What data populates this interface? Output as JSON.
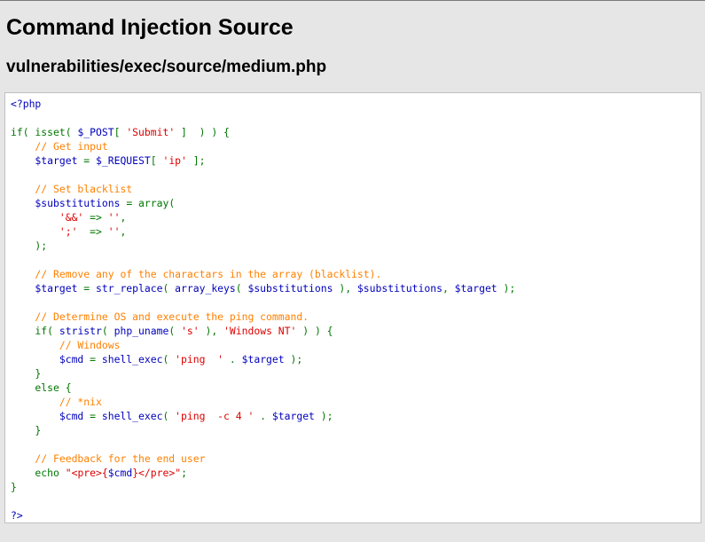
{
  "page": {
    "title": "Command Injection Source",
    "file_path": "vulnerabilities/exec/source/medium.php"
  },
  "code_lines": [
    [
      {
        "c": "kw",
        "t": "<?php"
      }
    ],
    [],
    [
      {
        "c": "grn",
        "t": "if( isset( "
      },
      {
        "c": "kw",
        "t": "$_POST"
      },
      {
        "c": "grn",
        "t": "[ "
      },
      {
        "c": "str",
        "t": "'Submit'"
      },
      {
        "c": "grn",
        "t": " ]  ) ) {"
      }
    ],
    [
      {
        "c": "com",
        "t": "    // Get input"
      }
    ],
    [
      {
        "c": "kw",
        "t": "    $target "
      },
      {
        "c": "grn",
        "t": "= "
      },
      {
        "c": "kw",
        "t": "$_REQUEST"
      },
      {
        "c": "grn",
        "t": "[ "
      },
      {
        "c": "str",
        "t": "'ip'"
      },
      {
        "c": "grn",
        "t": " ];"
      }
    ],
    [],
    [
      {
        "c": "com",
        "t": "    // Set blacklist"
      }
    ],
    [
      {
        "c": "kw",
        "t": "    $substitutions "
      },
      {
        "c": "grn",
        "t": "= array("
      }
    ],
    [
      {
        "c": "str",
        "t": "        '&&'"
      },
      {
        "c": "grn",
        "t": " => "
      },
      {
        "c": "str",
        "t": "''"
      },
      {
        "c": "grn",
        "t": ","
      }
    ],
    [
      {
        "c": "str",
        "t": "        ';'"
      },
      {
        "c": "grn",
        "t": "  => "
      },
      {
        "c": "str",
        "t": "''"
      },
      {
        "c": "grn",
        "t": ","
      }
    ],
    [
      {
        "c": "grn",
        "t": "    );"
      }
    ],
    [],
    [
      {
        "c": "com",
        "t": "    // Remove any of the charactars in the array (blacklist)."
      }
    ],
    [
      {
        "c": "kw",
        "t": "    $target "
      },
      {
        "c": "grn",
        "t": "= "
      },
      {
        "c": "kw",
        "t": "str_replace"
      },
      {
        "c": "grn",
        "t": "( "
      },
      {
        "c": "kw",
        "t": "array_keys"
      },
      {
        "c": "grn",
        "t": "( "
      },
      {
        "c": "kw",
        "t": "$substitutions "
      },
      {
        "c": "grn",
        "t": "), "
      },
      {
        "c": "kw",
        "t": "$substitutions"
      },
      {
        "c": "grn",
        "t": ", "
      },
      {
        "c": "kw",
        "t": "$target "
      },
      {
        "c": "grn",
        "t": ");"
      }
    ],
    [],
    [
      {
        "c": "com",
        "t": "    // Determine OS and execute the ping command."
      }
    ],
    [
      {
        "c": "grn",
        "t": "    if( "
      },
      {
        "c": "kw",
        "t": "stristr"
      },
      {
        "c": "grn",
        "t": "( "
      },
      {
        "c": "kw",
        "t": "php_uname"
      },
      {
        "c": "grn",
        "t": "( "
      },
      {
        "c": "str",
        "t": "'s'"
      },
      {
        "c": "grn",
        "t": " ), "
      },
      {
        "c": "str",
        "t": "'Windows NT'"
      },
      {
        "c": "grn",
        "t": " ) ) {"
      }
    ],
    [
      {
        "c": "com",
        "t": "        // Windows"
      }
    ],
    [
      {
        "c": "kw",
        "t": "        $cmd "
      },
      {
        "c": "grn",
        "t": "= "
      },
      {
        "c": "kw",
        "t": "shell_exec"
      },
      {
        "c": "grn",
        "t": "( "
      },
      {
        "c": "str",
        "t": "'ping  '"
      },
      {
        "c": "grn",
        "t": " . "
      },
      {
        "c": "kw",
        "t": "$target "
      },
      {
        "c": "grn",
        "t": ");"
      }
    ],
    [
      {
        "c": "grn",
        "t": "    }"
      }
    ],
    [
      {
        "c": "grn",
        "t": "    else {"
      }
    ],
    [
      {
        "c": "com",
        "t": "        // *nix"
      }
    ],
    [
      {
        "c": "kw",
        "t": "        $cmd "
      },
      {
        "c": "grn",
        "t": "= "
      },
      {
        "c": "kw",
        "t": "shell_exec"
      },
      {
        "c": "grn",
        "t": "( "
      },
      {
        "c": "str",
        "t": "'ping  -c 4 '"
      },
      {
        "c": "grn",
        "t": " . "
      },
      {
        "c": "kw",
        "t": "$target "
      },
      {
        "c": "grn",
        "t": ");"
      }
    ],
    [
      {
        "c": "grn",
        "t": "    }"
      }
    ],
    [],
    [
      {
        "c": "com",
        "t": "    // Feedback for the end user"
      }
    ],
    [
      {
        "c": "grn",
        "t": "    echo "
      },
      {
        "c": "str",
        "t": "\"<pre>{"
      },
      {
        "c": "kw",
        "t": "$cmd"
      },
      {
        "c": "str",
        "t": "}</pre>\""
      },
      {
        "c": "grn",
        "t": ";"
      }
    ],
    [
      {
        "c": "grn",
        "t": "}"
      }
    ],
    [],
    [
      {
        "c": "kw",
        "t": "?>"
      }
    ]
  ]
}
